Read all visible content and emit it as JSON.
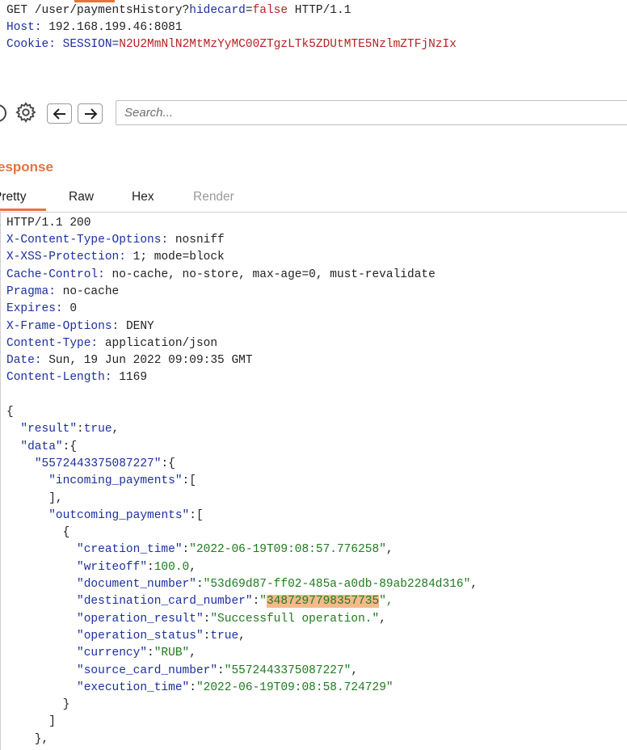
{
  "request": {
    "line1": {
      "method": "GET",
      "path": "/user/paymentsHistory?",
      "param_key": "hidecard",
      "eq": "=",
      "param_val": "false",
      "protocol": "HTTP/1.1"
    },
    "host": {
      "key": "Host",
      "value": "192.168.199.46:8081"
    },
    "cookie": {
      "key": "Cookie",
      "name": "SESSION",
      "value": "N2U2MmNlN2MtMzYyMC00ZTgzLTk5ZDUtMTE5NzlmZTFjNzIx"
    }
  },
  "toolbar": {
    "search_placeholder": "Search..."
  },
  "response": {
    "title": "esponse",
    "tabs": [
      "Pretty",
      "Raw",
      "Hex",
      "Render"
    ],
    "active_tab": "Pretty",
    "status_line": "HTTP/1.1 200",
    "headers": [
      {
        "key": "X-Content-Type-Options",
        "value": "nosniff"
      },
      {
        "key": "X-XSS-Protection",
        "value": "1; mode=block"
      },
      {
        "key": "Cache-Control",
        "value": "no-cache, no-store, max-age=0, must-revalidate"
      },
      {
        "key": "Pragma",
        "value": "no-cache"
      },
      {
        "key": "Expires",
        "value": "0"
      },
      {
        "key": "X-Frame-Options",
        "value": "DENY"
      },
      {
        "key": "Content-Type",
        "value": "application/json"
      },
      {
        "key": "Date",
        "value": "Sun, 19 Jun 2022 09:09:35 GMT"
      },
      {
        "key": "Content-Length",
        "value": "1169"
      }
    ],
    "json": {
      "result_key": "\"result\"",
      "result_val": "true",
      "data_key": "\"data\"",
      "card_key": "\"5572443375087227\"",
      "incoming_key": "\"incoming_payments\"",
      "outcoming_key": "\"outcoming_payments\"",
      "fields": [
        {
          "key": "\"creation_time\"",
          "value": "\"2022-06-19T09:08:57.776258\"",
          "sep": ","
        },
        {
          "key": "\"writeoff\"",
          "value": "100.0",
          "sep": ","
        },
        {
          "key": "\"document_number\"",
          "value": "\"53d69d87-ff02-485a-a0db-89ab2284d316\"",
          "sep": ","
        },
        {
          "key": "\"destination_card_number\"",
          "value": "3487297798357735",
          "sep": "\",",
          "highlight": true
        },
        {
          "key": "\"operation_result\"",
          "value": "\"Successfull operation.\"",
          "sep": ","
        },
        {
          "key": "\"operation_status\"",
          "value": "true",
          "sep": ","
        },
        {
          "key": "\"currency\"",
          "value": "\"RUB\"",
          "sep": ","
        },
        {
          "key": "\"source_card_number\"",
          "value": "\"5572443375087227\"",
          "sep": ","
        },
        {
          "key": "\"execution_time\"",
          "value": "\"2022-06-19T09:08:58.724729\"",
          "sep": ""
        }
      ]
    }
  },
  "colors": {
    "accent": "#e8743b",
    "json_key": "#1c2f9e",
    "json_string": "#1f7a1f",
    "header_red": "#b62222",
    "highlight": "#f7b98a"
  }
}
